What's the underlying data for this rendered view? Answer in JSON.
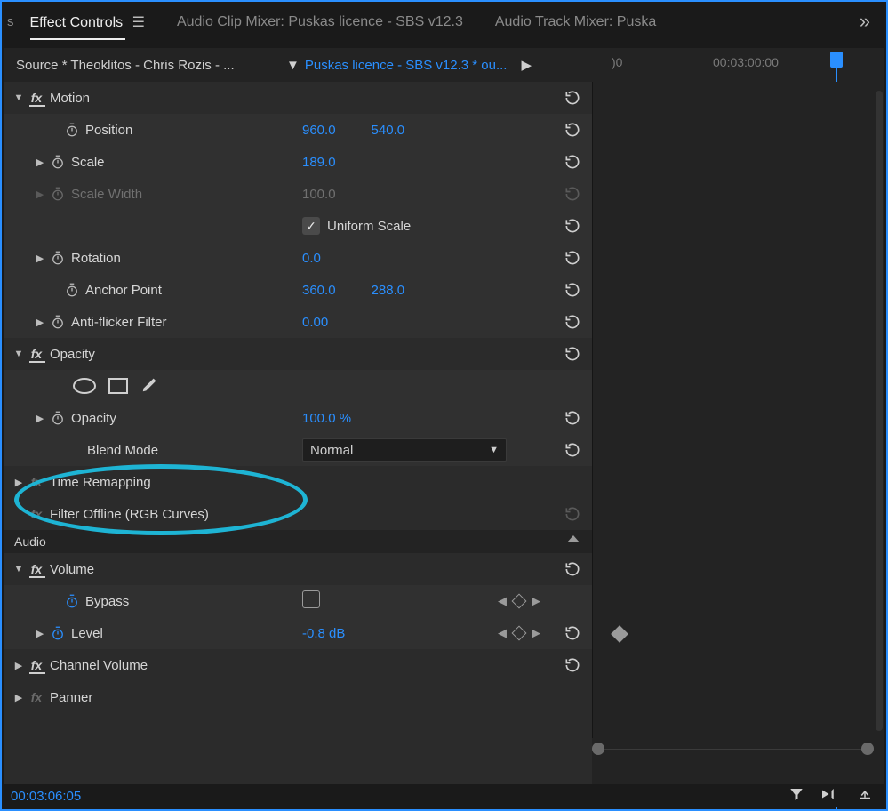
{
  "tabs": {
    "left_trunc": "s",
    "active": "Effect Controls",
    "t2": "Audio Clip Mixer: Puskas licence - SBS v12.3",
    "t3": "Audio Track Mixer: Puska",
    "overflow": "»"
  },
  "source": {
    "label": "Source * Theoklitos - Chris Rozis - ...",
    "sequence": "Puskas licence - SBS v12.3 * ou...",
    "ruler_start": ")0",
    "ruler_tick": "00:03:00:00"
  },
  "fx": {
    "motion": {
      "title": "Motion",
      "position": {
        "label": "Position",
        "x": "960.0",
        "y": "540.0"
      },
      "scale": {
        "label": "Scale",
        "v": "189.0"
      },
      "scale_width": {
        "label": "Scale Width",
        "v": "100.0"
      },
      "uniform": {
        "label": "Uniform Scale"
      },
      "rotation": {
        "label": "Rotation",
        "v": "0.0"
      },
      "anchor": {
        "label": "Anchor Point",
        "x": "360.0",
        "y": "288.0"
      },
      "antiflicker": {
        "label": "Anti-flicker Filter",
        "v": "0.00"
      }
    },
    "opacity": {
      "title": "Opacity",
      "opacity": {
        "label": "Opacity",
        "v": "100.0 %"
      },
      "blend": {
        "label": "Blend Mode",
        "v": "Normal"
      }
    },
    "time_remap": {
      "title": "Time Remapping"
    },
    "filter_offline": {
      "title": "Filter Offline (RGB Curves)"
    },
    "audio_section": "Audio",
    "volume": {
      "title": "Volume",
      "bypass": {
        "label": "Bypass"
      },
      "level": {
        "label": "Level",
        "v": "-0.8 dB"
      }
    },
    "channel_volume": {
      "title": "Channel Volume"
    },
    "panner": {
      "title": "Panner"
    }
  },
  "footer": {
    "timecode": "00:03:06:05"
  }
}
